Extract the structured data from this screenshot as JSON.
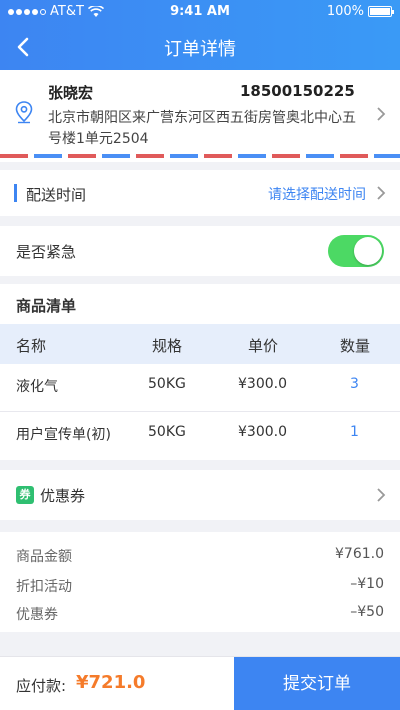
{
  "status_bar": {
    "carrier": "AT&T",
    "time": "9:41 AM",
    "battery": "100%"
  },
  "nav": {
    "title": "订单详情"
  },
  "address": {
    "name": "张晓宏",
    "phone": "18500150225",
    "line": "北京市朝阳区来广营东河区西五街房管奥北中心五号楼1单元2504"
  },
  "delivery": {
    "label": "配送时间",
    "action": "请选择配送时间"
  },
  "urgent": {
    "label": "是否紧急",
    "enabled": true
  },
  "goods": {
    "title": "商品清单",
    "headers": [
      "名称",
      "规格",
      "单价",
      "数量"
    ],
    "rows": [
      {
        "name": "液化气",
        "spec": "50KG",
        "price": "¥300.0",
        "qty": "3"
      },
      {
        "name": "用户宣传单(初)",
        "spec": "50KG",
        "price": "¥300.0",
        "qty": "1"
      }
    ]
  },
  "coupon": {
    "tag": "券",
    "label": "优惠券"
  },
  "summary": {
    "items": [
      {
        "label": "商品金额",
        "value": "¥761.0"
      },
      {
        "label": "折扣活动",
        "value": "–¥10"
      },
      {
        "label": "优惠券",
        "value": "–¥50"
      }
    ]
  },
  "footer": {
    "pay_label": "应付款:",
    "pay_value": "¥721.0",
    "submit_label": "提交订单"
  },
  "colors": {
    "accent": "#3d85f2",
    "price": "#f57b2a",
    "toggle_on": "#4cd964",
    "coupon_tag": "#2fbf71"
  }
}
